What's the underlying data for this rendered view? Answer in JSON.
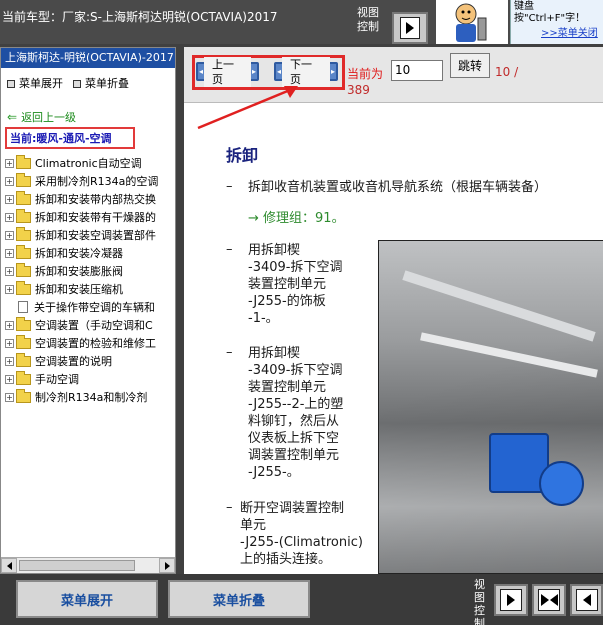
{
  "topbar": {
    "car_label": "当前车型：厂家:S-上海斯柯达明锐(OCTAVIA)2017",
    "view_control_label": "视图控制",
    "tip_text": "键盘按\"Ctrl+F\"字！",
    "tip_link": ">>菜单关闭"
  },
  "left_panel": {
    "title": "上海斯柯达-明锐(OCTAVIA)-2017",
    "expand_menu": "菜单展开",
    "collapse_menu": "菜单折叠",
    "back_link": "返回上一级",
    "current": "当前:暖风-通风-空调",
    "tree": [
      {
        "label": "Climatronic自动空调",
        "type": "folder"
      },
      {
        "label": "采用制冷剂R134a的空调",
        "type": "folder"
      },
      {
        "label": "拆卸和安装带内部热交换",
        "type": "folder"
      },
      {
        "label": "拆卸和安装带有干燥器的",
        "type": "folder"
      },
      {
        "label": "拆卸和安装空调装置部件",
        "type": "folder"
      },
      {
        "label": "拆卸和安装冷凝器",
        "type": "folder"
      },
      {
        "label": "拆卸和安装膨胀阀",
        "type": "folder"
      },
      {
        "label": "拆卸和安装压缩机",
        "type": "folder"
      },
      {
        "label": "关于操作带空调的车辆和",
        "type": "doc"
      },
      {
        "label": "空调装置（手动空调和C",
        "type": "folder"
      },
      {
        "label": "空调装置的检验和维修工",
        "type": "folder"
      },
      {
        "label": "空调装置的说明",
        "type": "folder"
      },
      {
        "label": "手动空调",
        "type": "folder"
      },
      {
        "label": "制冷剂R134a和制冷剂",
        "type": "folder"
      }
    ]
  },
  "content": {
    "prev_page": "上一页",
    "next_page": "下一页",
    "current_page_label": "当前为",
    "current_page_value": "10",
    "goto_button": "跳转",
    "page_count_a": "10 /",
    "page_count_b": "389",
    "section_title": "拆卸",
    "step1": "拆卸收音机装置或收音机导航系统（根据车辆装备）",
    "repair_group": "→ 修理组：91。",
    "step2": [
      "用拆卸楔",
      "-3409-拆下空调",
      "装置控制单元",
      "-J255-的饰板",
      "-1-。"
    ],
    "step3": [
      "用拆卸楔",
      "-3409-拆下空调",
      "装置控制单元",
      "-J255--2-上的塑",
      "料铆钉，然后从",
      "仪表板上拆下空",
      "调装置控制单元",
      "-J255-。"
    ],
    "step4": [
      "断开空调装置控制",
      "单元",
      "-J255-(Climatronic)",
      "上的插头连接。"
    ]
  },
  "bottombar": {
    "expand_menu": "菜单展开",
    "collapse_menu": "菜单折叠",
    "view_control_label": "视图控制"
  }
}
